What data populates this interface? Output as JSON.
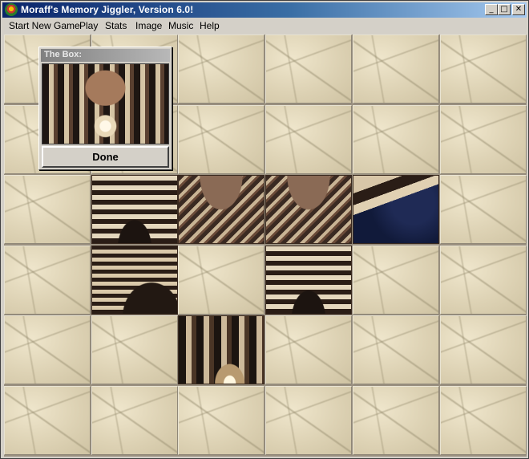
{
  "window": {
    "title": "Moraff's Memory Jiggler, Version 6.0!",
    "icon": "app-globe-icon",
    "controls": {
      "minimize": "_",
      "maximize": "□",
      "close": "✕"
    }
  },
  "menu": {
    "items": [
      "Start New Game",
      "Play",
      "Stats",
      "Image",
      "Music",
      "Help"
    ]
  },
  "board": {
    "columns": 6,
    "rows": 6,
    "revealed_tiles": [
      {
        "row": 3,
        "col": 2,
        "style": "arches"
      },
      {
        "row": 3,
        "col": 3,
        "style": "vault"
      },
      {
        "row": 3,
        "col": 4,
        "style": "vault"
      },
      {
        "row": 3,
        "col": 5,
        "style": "dark"
      },
      {
        "row": 4,
        "col": 2,
        "style": "arcade"
      },
      {
        "row": 4,
        "col": 4,
        "style": "arches"
      },
      {
        "row": 5,
        "col": 3,
        "style": "deep"
      }
    ]
  },
  "box_panel": {
    "caption": "The Box:",
    "done_label": "Done"
  }
}
